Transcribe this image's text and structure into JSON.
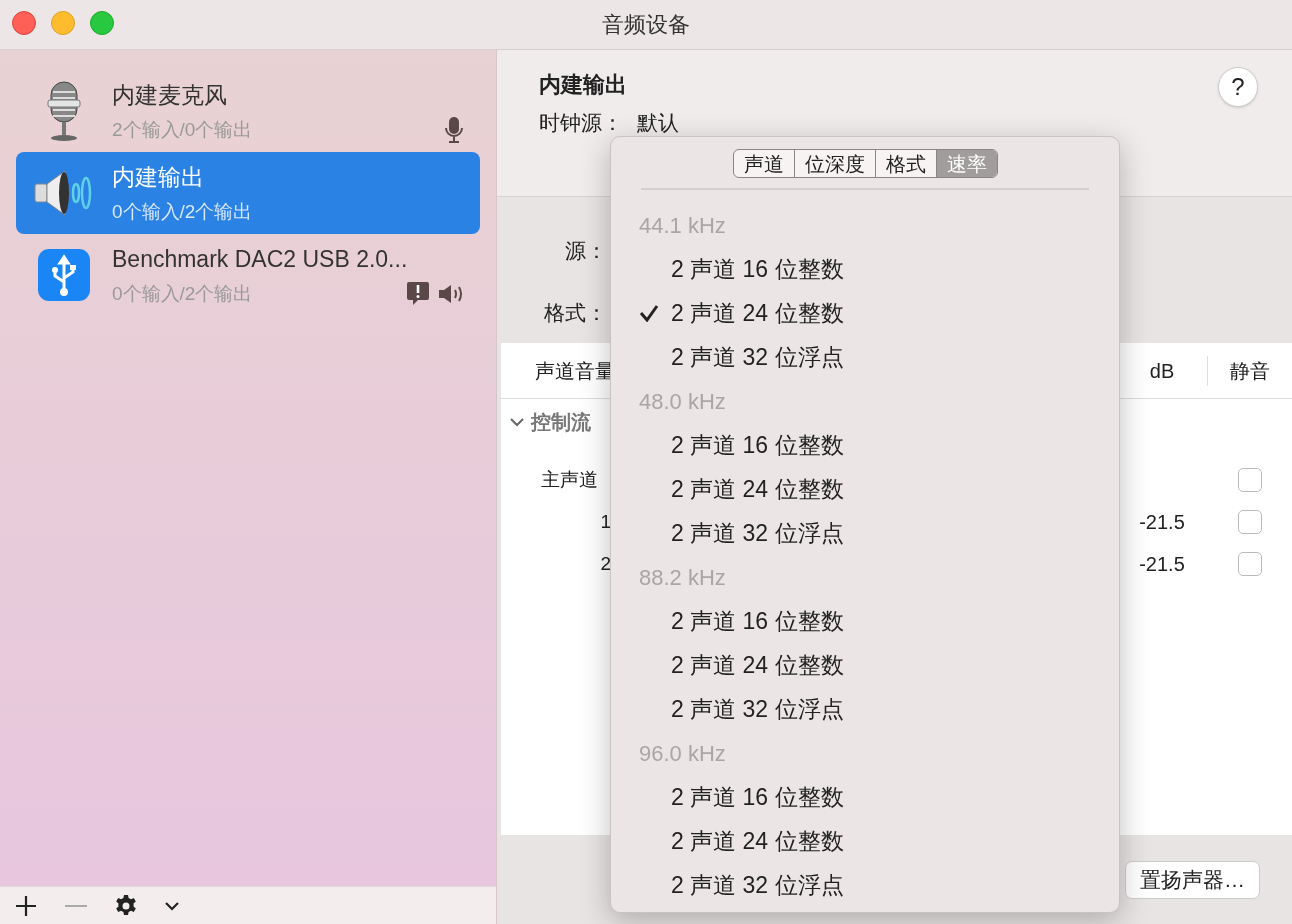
{
  "window": {
    "title": "音频设备"
  },
  "sidebar": {
    "devices": [
      {
        "kind": "microphone",
        "name": "内建麦克风",
        "io": "2个输入/0个输出",
        "selected": false,
        "default_input": true,
        "default_output": false,
        "alert": false
      },
      {
        "kind": "speaker",
        "name": "内建输出",
        "io": "0个输入/2个输出",
        "selected": true,
        "default_input": false,
        "default_output": false,
        "alert": false
      },
      {
        "kind": "usb",
        "name": "Benchmark DAC2 USB 2.0...",
        "io": "0个输入/2个输出",
        "selected": false,
        "default_input": false,
        "default_output": true,
        "alert": true
      }
    ]
  },
  "detail": {
    "title": "内建输出",
    "clock_label": "时钟源：",
    "clock_value": "默认",
    "source_label": "源：",
    "format_label": "格式：",
    "table": {
      "columns": [
        "声道音量",
        "dB",
        "静音"
      ],
      "groups": [
        {
          "label": "控制流",
          "expanded": true,
          "rows": [
            {
              "channel": "主声道",
              "muted": false
            },
            {
              "channel": "1",
              "db": "-21.5",
              "muted": false
            },
            {
              "channel": "2",
              "db": "-21.5",
              "muted": false
            }
          ]
        }
      ]
    },
    "configure_button": "置扬声器…",
    "help_button": "?"
  },
  "popup": {
    "tabs": [
      {
        "label": "声道",
        "selected": false
      },
      {
        "label": "位深度",
        "selected": false
      },
      {
        "label": "格式",
        "selected": false
      },
      {
        "label": "速率",
        "selected": true
      }
    ],
    "groups": [
      {
        "label": "44.1 kHz",
        "items": [
          {
            "label": "2 声道 16 位整数",
            "checked": false
          },
          {
            "label": "2 声道 24 位整数",
            "checked": true
          },
          {
            "label": "2 声道 32 位浮点",
            "checked": false
          }
        ]
      },
      {
        "label": "48.0 kHz",
        "items": [
          {
            "label": "2 声道 16 位整数",
            "checked": false
          },
          {
            "label": "2 声道 24 位整数",
            "checked": false
          },
          {
            "label": "2 声道 32 位浮点",
            "checked": false
          }
        ]
      },
      {
        "label": "88.2 kHz",
        "items": [
          {
            "label": "2 声道 16 位整数",
            "checked": false
          },
          {
            "label": "2 声道 24 位整数",
            "checked": false
          },
          {
            "label": "2 声道 32 位浮点",
            "checked": false
          }
        ]
      },
      {
        "label": "96.0 kHz",
        "items": [
          {
            "label": "2 声道 16 位整数",
            "checked": false
          },
          {
            "label": "2 声道 24 位整数",
            "checked": false
          },
          {
            "label": "2 声道 32 位浮点",
            "checked": false
          }
        ]
      }
    ]
  }
}
